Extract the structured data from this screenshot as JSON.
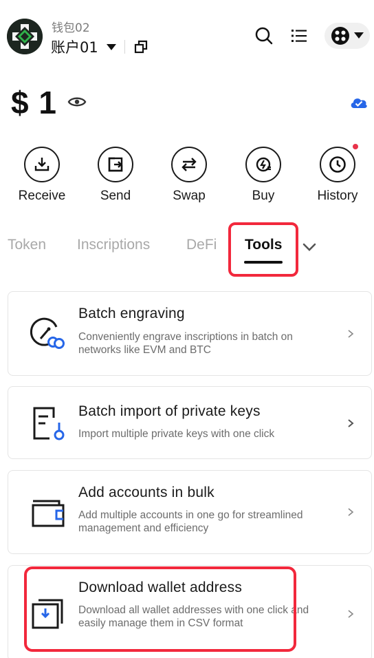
{
  "header": {
    "wallet_name": "钱包02",
    "account_name": "账户01"
  },
  "balance": {
    "amount": "$ 1"
  },
  "actions": [
    {
      "label": "Receive"
    },
    {
      "label": "Send"
    },
    {
      "label": "Swap"
    },
    {
      "label": "Buy"
    },
    {
      "label": "History"
    }
  ],
  "tabs": [
    {
      "label": "Token"
    },
    {
      "label": "Inscriptions"
    },
    {
      "label": "DeFi"
    },
    {
      "label": "Tools",
      "active": true
    }
  ],
  "cards": [
    {
      "title": "Batch engraving",
      "desc": "Conveniently engrave inscriptions in batch on networks like EVM and BTC"
    },
    {
      "title": "Batch import of private keys",
      "desc": "Import multiple private keys with one click"
    },
    {
      "title": "Add accounts in bulk",
      "desc": "Add multiple accounts in one go for streamlined management and efficiency"
    },
    {
      "title": "Download wallet address",
      "desc": "Download all wallet addresses with one click and easily manage them in CSV format"
    }
  ],
  "colors": {
    "accent_blue": "#2666e8",
    "highlight_red": "#f2283c",
    "notification_dot": "#e8334a"
  }
}
